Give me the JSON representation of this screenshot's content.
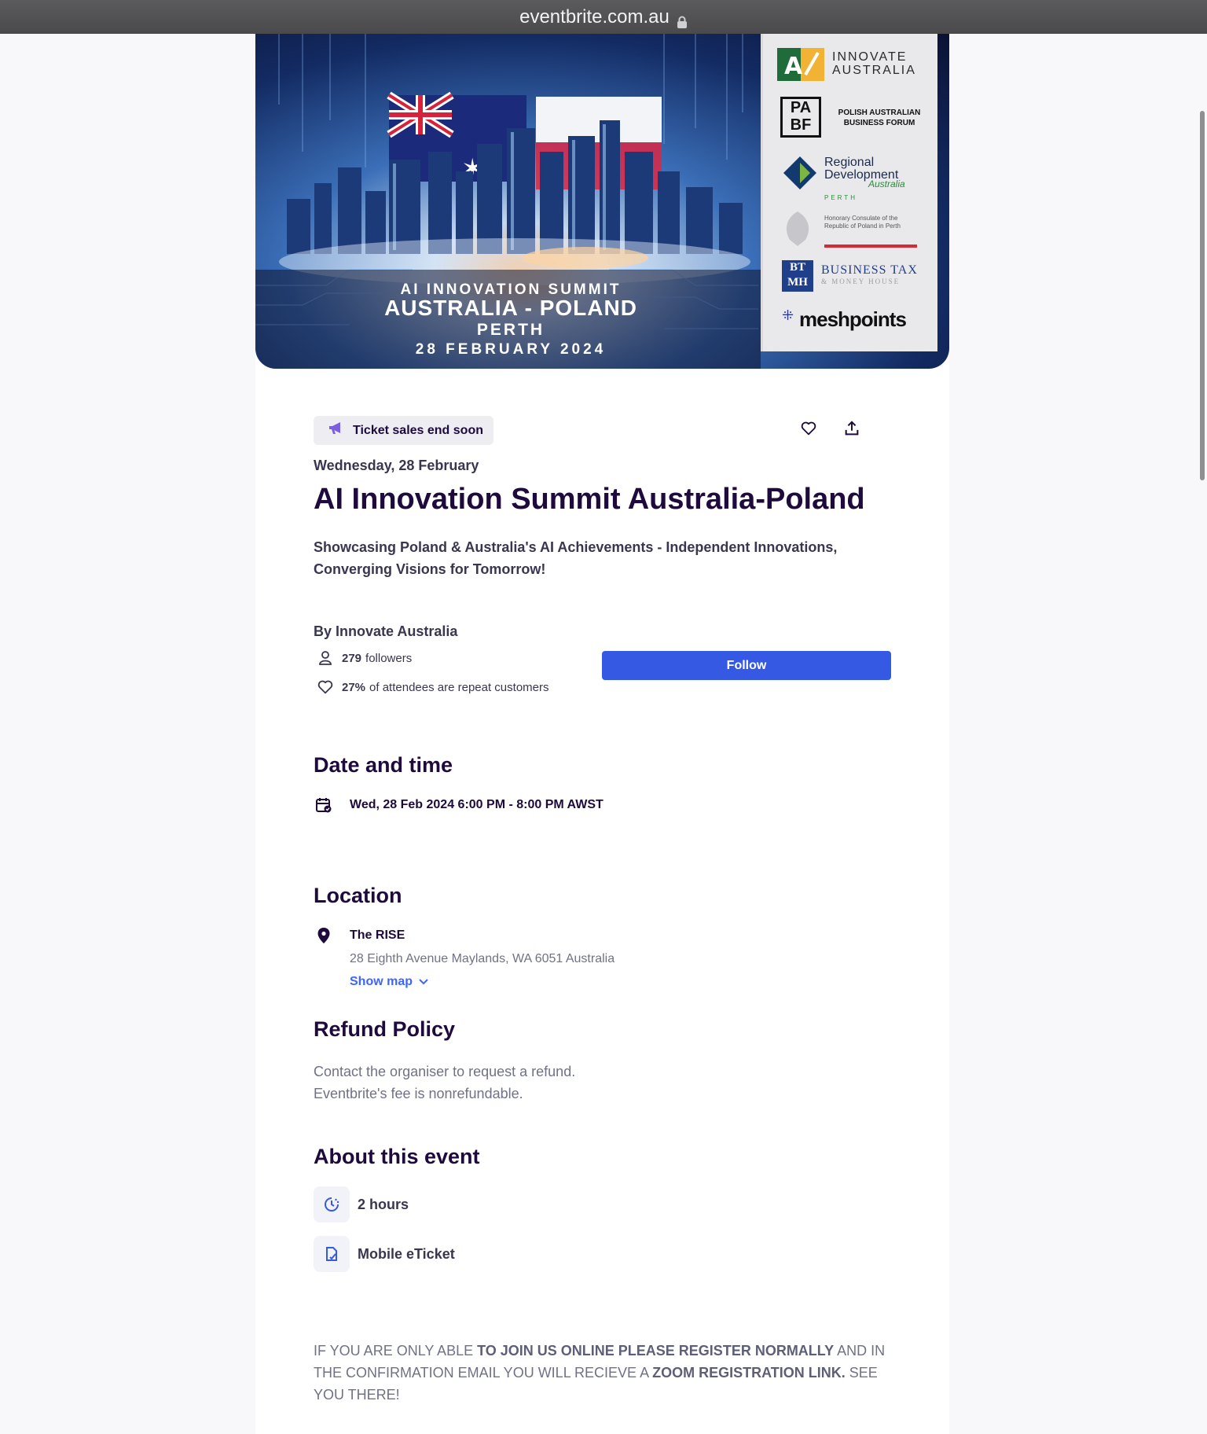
{
  "browser": {
    "url": "eventbrite.com.au"
  },
  "hero": {
    "line1": "AI INNOVATION SUMMIT",
    "line2": "AUSTRALIA - POLAND",
    "line3": "PERTH",
    "line4": "28 FEBRUARY 2024",
    "sponsors": {
      "innovate": "INNOVATE AUSTRALIA",
      "pabf_logo": "PA BF",
      "pabf_name": "POLISH AUSTRALIAN BUSINESS FORUM",
      "rda_name": "Regional Development",
      "rda_sub": "Australia",
      "rda_city": "PERTH",
      "consulate": "Honorary Consulate of the Republic of Poland in Perth",
      "btmh_logo": "BT MH",
      "btmh_name": "BUSINESS TAX",
      "btmh_sub": "& MONEY HOUSE",
      "meshpoints": "meshpoints"
    }
  },
  "urgency": {
    "label": "Ticket sales end soon"
  },
  "actions": {
    "like_icon": "heart-icon",
    "share_icon": "share-icon"
  },
  "event": {
    "date_small": "Wednesday, 28 February",
    "title": "AI Innovation Summit Australia-Poland",
    "summary": "Showcasing Poland & Australia's AI Achievements - Independent Innovations, Converging Visions for Tomorrow!"
  },
  "organizer": {
    "by": "By Innovate Australia",
    "followers_count": "279",
    "followers_label": "followers",
    "repeat_pct": "27%",
    "repeat_label": "of attendees are repeat customers",
    "follow_label": "Follow"
  },
  "date_time": {
    "heading": "Date and time",
    "value": "Wed, 28 Feb 2024 6:00 PM - 8:00 PM AWST"
  },
  "location": {
    "heading": "Location",
    "venue": "The RISE",
    "address": "28 Eighth Avenue Maylands, WA 6051 Australia",
    "show_map": "Show map"
  },
  "refund": {
    "heading": "Refund Policy",
    "line1": "Contact the organiser to request a refund.",
    "line2": "Eventbrite's fee is nonrefundable."
  },
  "about": {
    "heading": "About this event",
    "duration": "2 hours",
    "ticket_type": "Mobile eTicket"
  },
  "note": {
    "p1": "IF YOU ARE ONLY ABLE ",
    "b1": "TO JOIN US ONLINE PLEASE REGISTER NORMALLY",
    "p2": " AND IN THE CONFIRMATION EMAIL YOU WILL RECIEVE A ",
    "b2": "ZOOM REGISTRATION LINK.",
    "p3": " SEE YOU THERE!"
  },
  "colors": {
    "accent": "#3659e3",
    "link": "#3d64ff",
    "title": "#1e0a3c",
    "muted": "#6f7287",
    "pill_bg": "#eeedf2",
    "megaphone": "#7b5fe0"
  }
}
